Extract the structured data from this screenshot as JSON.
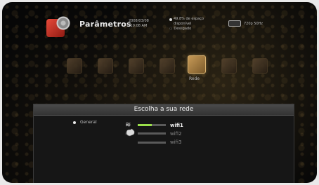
{
  "header": {
    "title": "Parâmetros",
    "date": "2008/03/08",
    "time": "10:08 AM",
    "status_line1": "49.8% de espaço",
    "status_line2": "disponível",
    "status_line3": "Desligado",
    "hdmi_label": "720p 50Hz"
  },
  "icon_bar": {
    "items": [
      {
        "icon": "menu-icon-1"
      },
      {
        "icon": "menu-icon-2"
      },
      {
        "icon": "menu-icon-3"
      },
      {
        "icon": "menu-icon-4"
      },
      {
        "icon": "network-icon",
        "active": true
      },
      {
        "icon": "menu-icon-6"
      },
      {
        "icon": "menu-icon-7"
      }
    ],
    "active_label": "Rede"
  },
  "dialog": {
    "title": "Escolha a sua rede",
    "option_label": "General",
    "networks": [
      {
        "name": "wifi1",
        "signal": 0.5,
        "selected": true
      },
      {
        "name": "wifi2",
        "signal": 0.0,
        "selected": false
      },
      {
        "name": "wifi3",
        "signal": 0.0,
        "selected": false
      }
    ]
  },
  "colors": {
    "signal": "#9adf4a",
    "accent": "#c79a57"
  }
}
